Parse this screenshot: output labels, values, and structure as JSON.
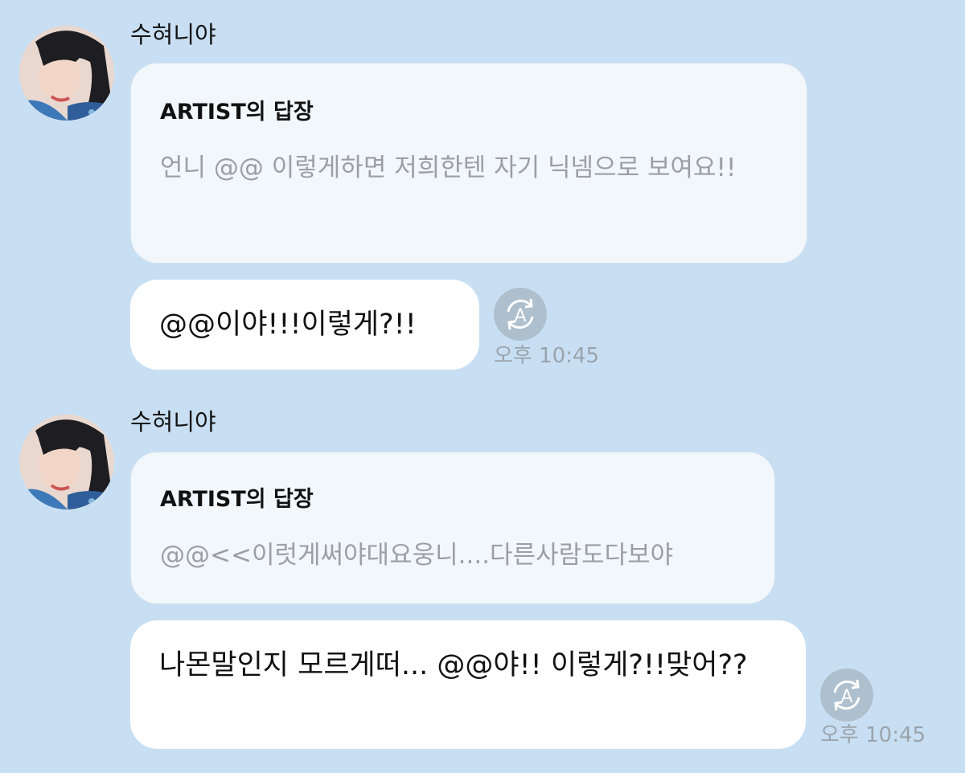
{
  "messages": [
    {
      "sender": "수혀니야",
      "reply": {
        "title": "ARTIST의 답장",
        "text": "언니 @@ 이렇게하면 저희한텐 자기 닉넴으로 보여요!!"
      },
      "text": "@@이야!!!이렇게?!!",
      "time": "오후 10:45",
      "translate_icon": "translate-icon"
    },
    {
      "sender": "수혀니야",
      "reply": {
        "title": "ARTIST의 답장",
        "text": "@@<<이럿게써야대요웅니....다른사람도다보야"
      },
      "text": "나몬말인지 모르게떠... @@야!! 이렇게?!!맞어??",
      "time": "오후 10:45",
      "translate_icon": "translate-icon"
    }
  ],
  "colors": {
    "background": "#c8dff3",
    "reply_card": "#f2f7fc",
    "bubble": "#ffffff",
    "muted_text": "#9b9fa4",
    "translate_button": "#aebfcd"
  }
}
